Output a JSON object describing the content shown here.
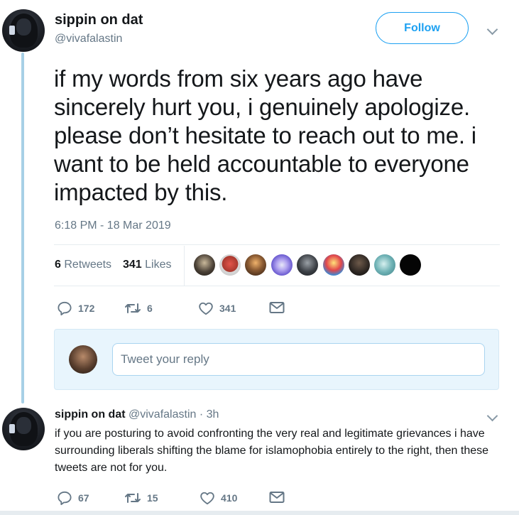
{
  "tweet": {
    "display_name": "sippin on dat",
    "handle": "@vivafalastin",
    "follow_label": "Follow",
    "text": "if my words from six years ago have sincerely hurt you, i genuinely apologize. please don’t hesitate to reach out to me. i want to be held accountable to everyone impacted by this.",
    "timestamp": "6:18 PM - 18 Mar 2019",
    "retweets_count": "6",
    "retweets_label": "Retweets",
    "likes_count": "341",
    "likes_label": "Likes",
    "replies": "172",
    "retweets": "6",
    "likes": "341"
  },
  "likers": [
    {
      "color": "#4a4036"
    },
    {
      "color": "#a8392f"
    },
    {
      "color": "#5a3a22"
    },
    {
      "color": "#7a6ad4"
    },
    {
      "color": "#3b3f45"
    },
    {
      "color": "#d8a63a"
    },
    {
      "color": "#2b2521"
    },
    {
      "color": "#6fb2b5"
    },
    {
      "color": "#050505"
    }
  ],
  "reply_box": {
    "placeholder": "Tweet your reply"
  },
  "reply_tweet": {
    "display_name": "sippin on dat",
    "handle": "@vivafalastin",
    "separator": "·",
    "time": "3h",
    "text": "if you are posturing to avoid confronting the very real and legitimate grievances i have surrounding liberals shifting the blame for islamophobia entirely to the right, then these tweets are not for you.",
    "replies": "67",
    "retweets": "15",
    "likes": "410"
  }
}
